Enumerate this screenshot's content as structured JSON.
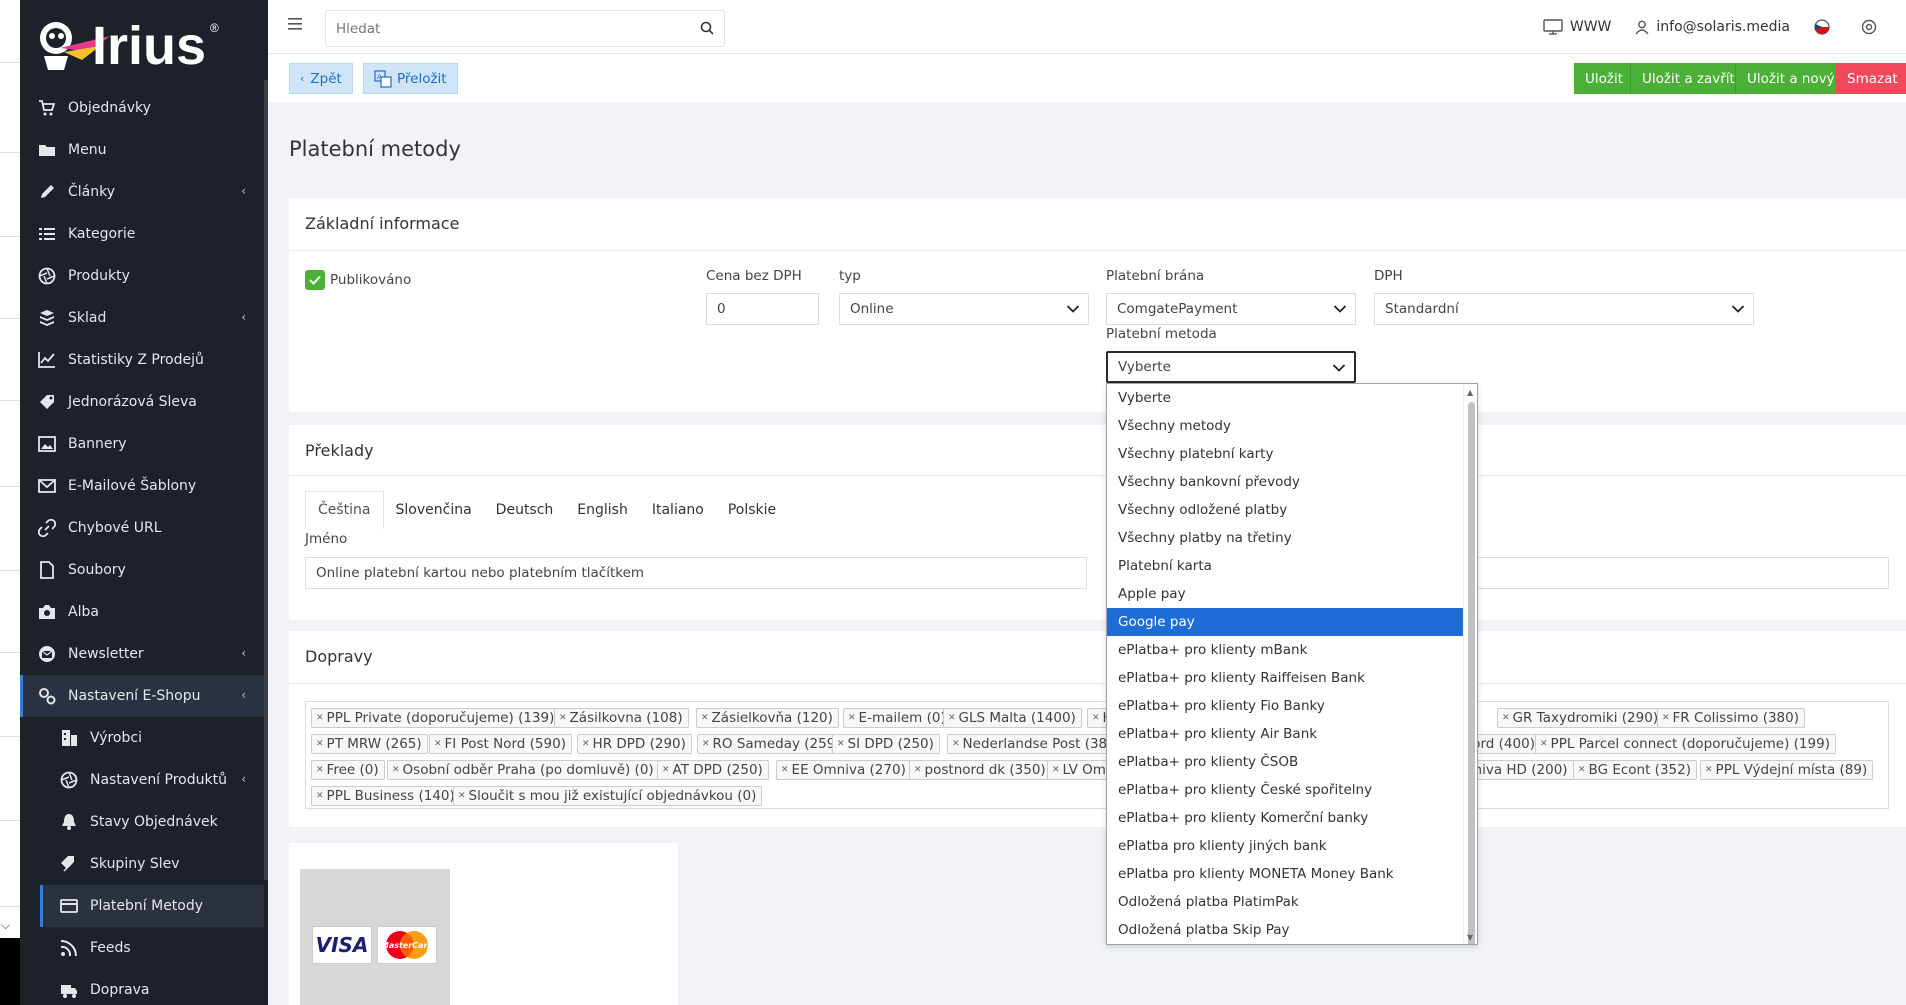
{
  "brand": {
    "name": "Irius",
    "registered": "®"
  },
  "sidebar": {
    "items": [
      {
        "label": "Objednávky",
        "icon": "cart-icon"
      },
      {
        "label": "Menu",
        "icon": "folder-icon"
      },
      {
        "label": "Články",
        "icon": "pen-icon",
        "has_children": true
      },
      {
        "label": "Kategorie",
        "icon": "list-icon"
      },
      {
        "label": "Produkty",
        "icon": "aperture-icon"
      },
      {
        "label": "Sklad",
        "icon": "boxes-icon",
        "has_children": true
      },
      {
        "label": "Statistiky Z Prodejů",
        "icon": "chart-icon"
      },
      {
        "label": "Jednorázová Sleva",
        "icon": "tag-icon"
      },
      {
        "label": "Bannery",
        "icon": "image-icon"
      },
      {
        "label": "E-Mailové Šablony",
        "icon": "mail-icon"
      },
      {
        "label": "Chybové URL",
        "icon": "link-icon"
      },
      {
        "label": "Soubory",
        "icon": "file-icon"
      },
      {
        "label": "Alba",
        "icon": "camera-icon"
      },
      {
        "label": "Newsletter",
        "icon": "envelope-circle-icon",
        "has_children": true
      },
      {
        "label": "Nastavení E-Shopu",
        "icon": "cogs-icon",
        "has_children": true,
        "open": true
      }
    ],
    "subitems": [
      {
        "label": "Výrobci",
        "icon": "building-icon"
      },
      {
        "label": "Nastavení Produktů",
        "icon": "aperture-icon",
        "has_children": true
      },
      {
        "label": "Stavy Objednávek",
        "icon": "bell-icon"
      },
      {
        "label": "Skupiny Slev",
        "icon": "tags-icon"
      },
      {
        "label": "Platební Metody",
        "icon": "credit-card-icon",
        "active": true
      },
      {
        "label": "Feeds",
        "icon": "rss-icon"
      },
      {
        "label": "Doprava",
        "icon": "truck-icon"
      }
    ]
  },
  "topbar": {
    "search_placeholder": "Hledat",
    "www_label": "WWW",
    "user_email": "info@solaris.media"
  },
  "actions": {
    "back": "Zpět",
    "translate": "Přeložit",
    "save": "Uložit",
    "save_close": "Uložit a zavřít",
    "save_new": "Uložit a nový",
    "delete": "Smazat"
  },
  "page_title": "Platební metody",
  "basic": {
    "title": "Základní informace",
    "published_label": "Publikováno",
    "price_label": "Cena bez DPH",
    "price_value": "0",
    "type_label": "typ",
    "type_value": "Online",
    "gateway_label": "Platební brána",
    "gateway_value": "ComgatePayment",
    "vat_label": "DPH",
    "vat_value": "Standardní",
    "method_label": "Platební metoda",
    "method_value": "Vyberte"
  },
  "method_options": [
    "Vyberte",
    "Všechny metody",
    "Všechny platební karty",
    "Všechny bankovní převody",
    "Všechny odložené platby",
    "Všechny platby na třetiny",
    "Platební karta",
    "Apple pay",
    "Google pay",
    "ePlatba+ pro klienty mBank",
    "ePlatba+ pro klienty Raiffeisen Bank",
    "ePlatba+ pro klienty Fio Banky",
    "ePlatba+ pro klienty Air Bank",
    "ePlatba+ pro klienty ČSOB",
    "ePlatba+ pro klienty České spořitelny",
    "ePlatba+ pro klienty Komerční banky",
    "ePlatba pro klienty jiných bank",
    "ePlatba pro klienty MONETA Money Bank",
    "Odložená platba PlatimPak",
    "Odložená platba Skip Pay"
  ],
  "method_selected_index": 8,
  "translations": {
    "title": "Překlady",
    "tabs": [
      "Čeština",
      "Slovenčina",
      "Deutsch",
      "English",
      "Italiano",
      "Polskie"
    ],
    "name_label": "Jméno",
    "name_value": "Online platební kartou nebo platebním tlačítkem"
  },
  "shipping": {
    "title": "Dopravy",
    "row1": [
      "PPL Private (doporučujeme) (139)",
      "Zásilkovna (108)",
      "Zásielkovňa (120)",
      "E-mailem (0)",
      "GLS Malta (1400)",
      "HU"
    ],
    "row1_right": [
      "GR Taxydromiki (290)",
      "FR Colissimo (380)"
    ],
    "row2": [
      "PT MRW (265)",
      "FI Post Nord (590)",
      "HR DPD (290)",
      "RO Sameday (259)",
      "SI DPD (250)",
      "Nederlandse Post (382)"
    ],
    "row2_right": [
      "t Nord (400)",
      "PPL Parcel connect (doporučujeme) (199)"
    ],
    "row3": [
      "Free (0)",
      "Osobní odběr Praha (po domluvě) (0)",
      "AT DPD (250)",
      "EE Omniva (270)",
      "postnord dk (350)",
      "LV Om"
    ],
    "row3_right": [
      "niva HD (200)",
      "BG Econt (352)",
      "PPL Výdejní místa (89)"
    ],
    "row4": [
      "PPL Business (140)",
      "Sloučit s mou již existující objednávkou (0)"
    ]
  },
  "cards": {
    "visa": "VISA",
    "mastercard": "MasterCard"
  },
  "colors": {
    "green": "#4caf37",
    "red": "#f0495c",
    "selected": "#1e6dd6",
    "sidebar": "#1d2129"
  }
}
